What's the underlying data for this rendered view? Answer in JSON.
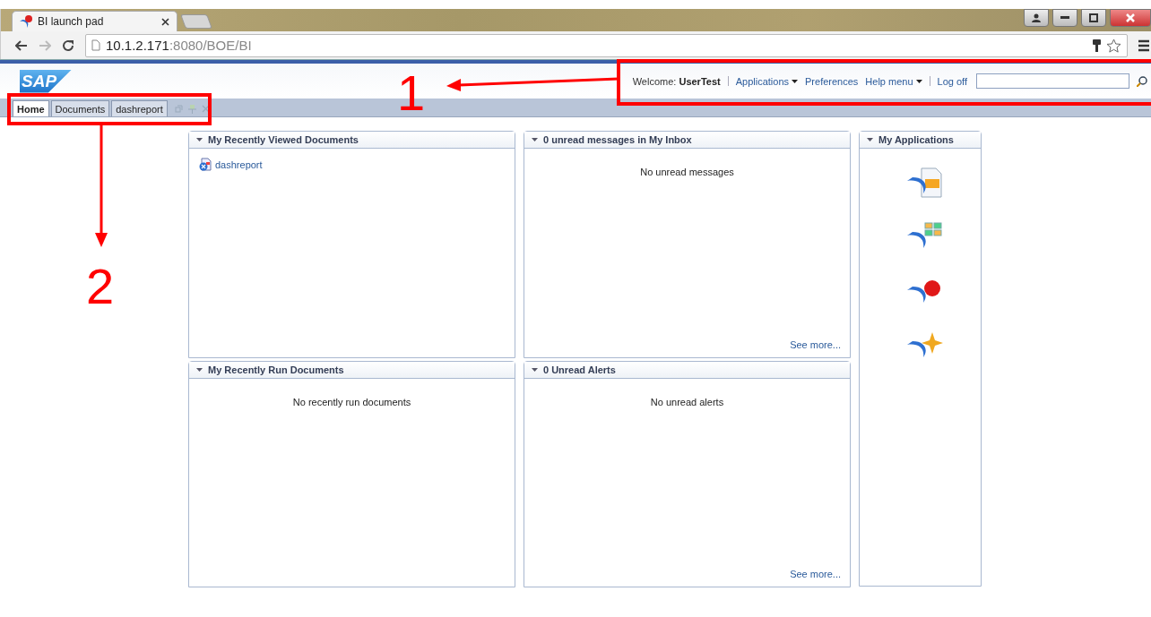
{
  "browser": {
    "tab_title": "BI launch pad",
    "address_host": "10.1.2.171",
    "address_path": ":8080/BOE/BI"
  },
  "header": {
    "logo": "SAP",
    "welcome_label": "Welcome:",
    "user": "UserTest",
    "menu": [
      {
        "label": "Applications",
        "dropdown": true
      },
      {
        "label": "Preferences",
        "dropdown": false
      },
      {
        "label": "Help menu",
        "dropdown": true
      }
    ],
    "logoff": "Log off"
  },
  "tabs": [
    {
      "label": "Home",
      "selected": true
    },
    {
      "label": "Documents",
      "selected": false
    },
    {
      "label": "dashreport",
      "selected": false
    }
  ],
  "panels": [
    {
      "title": "My Recently Viewed Documents",
      "kind": "list",
      "items": [
        "dashreport"
      ]
    },
    {
      "title": "0 unread messages in My Inbox",
      "kind": "message",
      "message": "No unread messages",
      "see_more": "See more..."
    },
    {
      "title": "My Recently Run Documents",
      "kind": "message",
      "message": "No recently run documents"
    },
    {
      "title": "0 Unread Alerts",
      "kind": "message",
      "message": "No unread alerts",
      "see_more": "See more..."
    }
  ],
  "applications": {
    "title": "My Applications",
    "apps": [
      {
        "kind": "ruler"
      },
      {
        "kind": "modules"
      },
      {
        "kind": "ball"
      },
      {
        "kind": "star"
      }
    ]
  },
  "annotations": [
    {
      "label": "1"
    },
    {
      "label": "2"
    }
  ]
}
